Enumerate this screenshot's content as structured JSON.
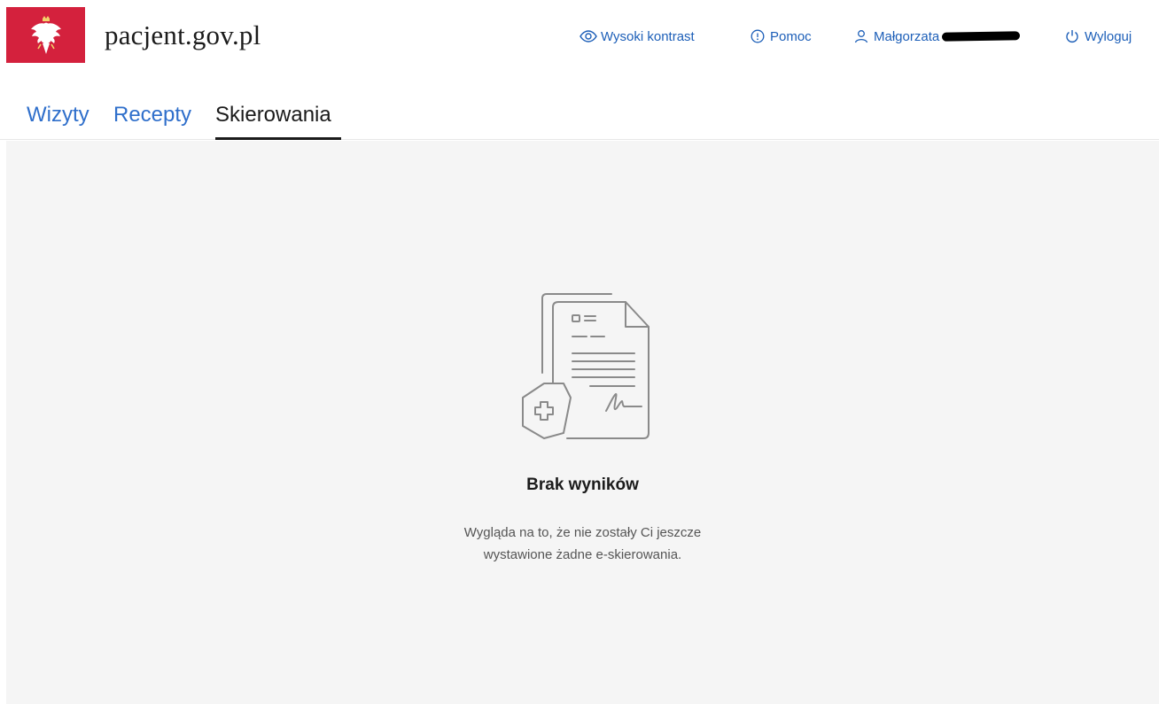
{
  "header": {
    "site_title": "pacjent.gov.pl",
    "actions": {
      "contrast": "Wysoki kontrast",
      "help": "Pomoc",
      "user": "Małgorzata",
      "logout": "Wyloguj"
    }
  },
  "tabs": [
    {
      "label": "Wizyty",
      "active": false
    },
    {
      "label": "Recepty",
      "active": false
    },
    {
      "label": "Skierowania",
      "active": true
    }
  ],
  "empty_state": {
    "title": "Brak wyników",
    "description_line1": "Wygląda na to, że nie zostały Ci jeszcze",
    "description_line2": "wystawione żadne e-skierowania."
  },
  "colors": {
    "emblem_red": "#d4213d",
    "link_blue": "#1d5fb8",
    "tab_blue": "#2f6fcb",
    "content_bg": "#f5f5f5",
    "illustration_gray": "#8a8a8a"
  },
  "icons": {
    "emblem": "polish-eagle-icon",
    "contrast": "eye-icon",
    "help": "info-circle-icon",
    "user": "user-icon",
    "logout": "power-icon",
    "illustration": "document-medical-icon"
  }
}
